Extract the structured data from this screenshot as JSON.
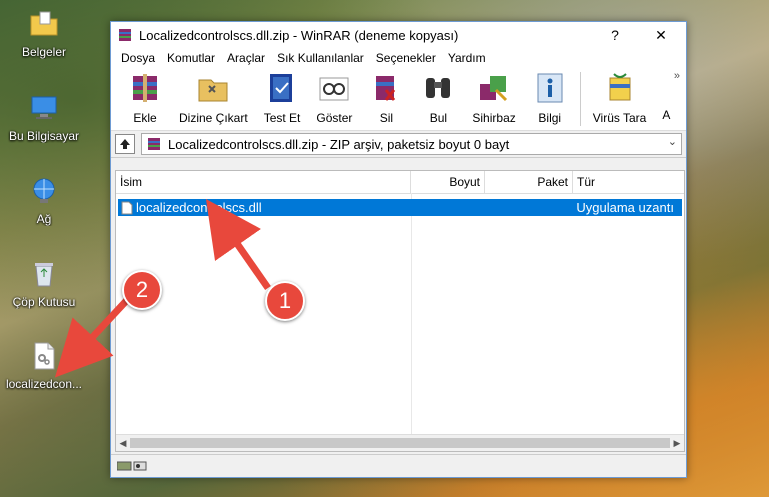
{
  "desktop": {
    "icons": [
      {
        "label": "Belgeler",
        "icon": "folder-icon"
      },
      {
        "label": "Bu Bilgisayar",
        "icon": "computer-icon"
      },
      {
        "label": "Ağ",
        "icon": "network-icon"
      },
      {
        "label": "Çöp Kutusu",
        "icon": "recycle-bin-icon"
      },
      {
        "label": "localizedcon...",
        "icon": "dll-file-icon"
      }
    ]
  },
  "window": {
    "title": "Localizedcontrolscs.dll.zip - WinRAR (deneme kopyası)",
    "help_glyph": "?",
    "close_glyph": "✕"
  },
  "menu": [
    "Dosya",
    "Komutlar",
    "Araçlar",
    "Sık Kullanılanlar",
    "Seçenekler",
    "Yardım"
  ],
  "toolbar": {
    "buttons": [
      "Ekle",
      "Dizine Çıkart",
      "Test Et",
      "Göster",
      "Sil",
      "Bul",
      "Sihirbaz",
      "Bilgi",
      "Virüs Tara",
      "A"
    ],
    "more_glyph": "»"
  },
  "address": {
    "text": "Localizedcontrolscs.dll.zip - ZIP arşiv, paketsiz boyut 0 bayt",
    "chevron": "⌄"
  },
  "list": {
    "columns": [
      "İsim",
      "Boyut",
      "Paket",
      "Tür"
    ],
    "rows": [
      {
        "name": "localizedcontrolscs.dll",
        "size": "",
        "packed": "",
        "type": "Uygulama uzantı"
      }
    ]
  },
  "annotations": {
    "badge1": "1",
    "badge2": "2"
  },
  "colors": {
    "selection": "#0078d7",
    "badge": "#e8483c"
  }
}
